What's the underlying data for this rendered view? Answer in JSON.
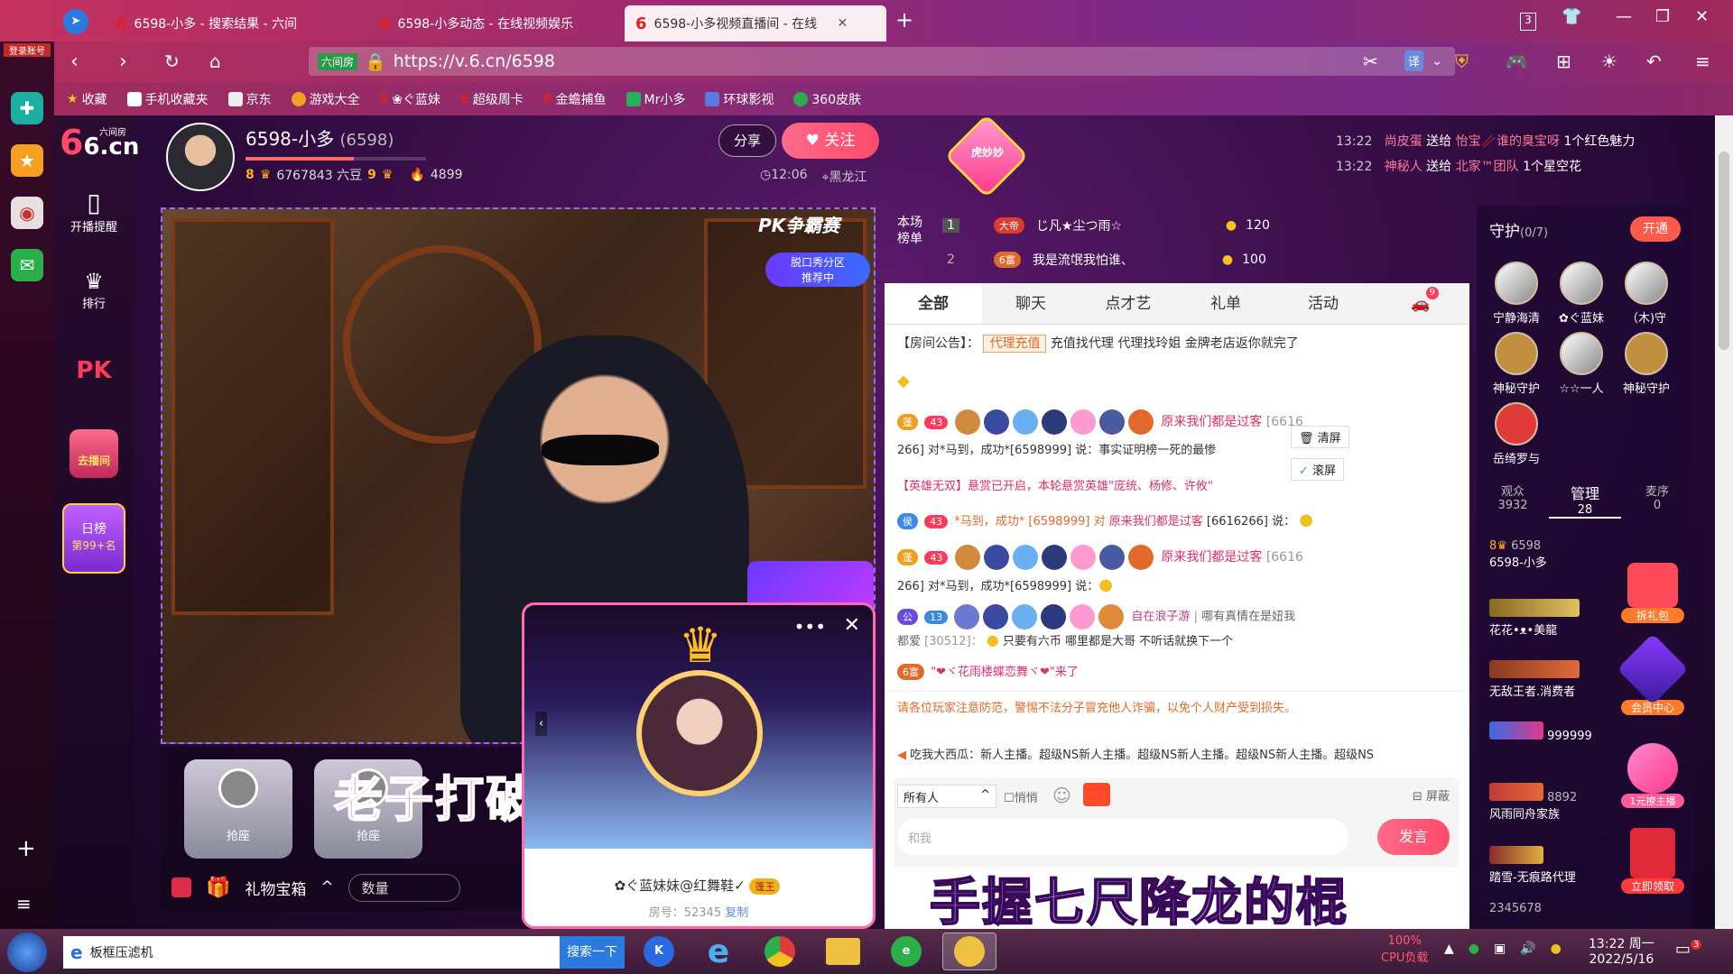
{
  "browser": {
    "tabs": [
      {
        "label": "6598-小多 - 搜索结果 - 六间"
      },
      {
        "label": "6598-小多动态 - 在线视频娱乐"
      },
      {
        "label": "6598-小多视频直播间 - 在线"
      }
    ],
    "tab_count_badge": "3",
    "url": "https://v.6.cn/6598",
    "url_badge": "六间房",
    "translate_label": "译",
    "bookmarks": [
      "收藏",
      "手机收藏夹",
      "京东",
      "游戏大全",
      "❀ぐ蓝妹",
      "超级周卡",
      "金蟾捕鱼",
      "Mr小多",
      "环球影视",
      "360皮肤"
    ]
  },
  "left_sidebar": {
    "login_label": "登录账号"
  },
  "site": {
    "logo_main": "6.cn",
    "logo_sub": "六间房",
    "nav": [
      {
        "label": "开播提醒"
      },
      {
        "label": "排行"
      },
      {
        "label": "PK"
      },
      {
        "label": "去播间"
      },
      {
        "label": "日榜",
        "sub": "第99+名"
      }
    ]
  },
  "streamer": {
    "name": "6598-小多",
    "room_id": "(6598)",
    "level_left": "8",
    "beans": "6767843 六豆",
    "level_right": "9",
    "fans": "4899",
    "time": "12:06",
    "location": "黑龙江",
    "share_label": "分享",
    "follow_label": "关注",
    "hu_label": "虎妙妙"
  },
  "ticker": [
    {
      "time": "13:22",
      "from": "尚皮蛋",
      "verb": "送给",
      "to": "怡宝🥢谁的臭宝呀",
      "gift": "1个红色魅力"
    },
    {
      "time": "13:22",
      "from": "神秘人",
      "verb": "送给",
      "to": "北家™团队",
      "gift": "1个星空花"
    }
  ],
  "video": {
    "pk_label": "PK争霸赛",
    "zone_label": "脱口秀分区",
    "zone_sub": "推荐中"
  },
  "controls": {
    "seats": [
      "抢座",
      "抢座"
    ],
    "gift_box_label": "礼物宝箱",
    "quantity_label": "数量"
  },
  "lyrics": {
    "line1": "老子打破这江湖的阵",
    "line2": "手握七尺降龙的棍"
  },
  "popup": {
    "name": "✿ぐ蓝妹妹@红舞鞋✓",
    "badge": "蓬王",
    "room": "房号：52345",
    "copy": "复制"
  },
  "rank": {
    "title": "本场榜单",
    "rows": [
      {
        "pos": "1",
        "badge": "大帝",
        "name": "じ凡★尘つ雨☆",
        "score": "120"
      },
      {
        "pos": "2",
        "badge": "6富",
        "name": "我是流氓我怕谁、",
        "score": "100"
      }
    ]
  },
  "chat": {
    "tabs": [
      "全部",
      "聊天",
      "点才艺",
      "礼单",
      "活动"
    ],
    "car_badge": "9",
    "announcement_prefix": "【房间公告】：",
    "announcement_tag": "代理充值",
    "announcement_text": "充值找代理 代理找玲姐 金牌老店返你就完了",
    "msg1_user": "原来我们都是过客",
    "msg1_line1_tail": "[6616",
    "msg1_line2": "266] 对*马到，成功*[6598999] 说：事实证明榜一死的最惨",
    "clear_label": "清屏",
    "scroll_label": "滚屏",
    "hero_text": "【英雄无双】悬赏已开启，本轮悬赏英雄\"庞统、杨修、许攸\"",
    "msg2_prefix": "*马到，成功* [6598999] 对",
    "msg2_user": "原来我们都是过客",
    "msg2_tail": "[6616266] 说：",
    "msg3_user": "原来我们都是过客",
    "msg3_line1_tail": "[6616",
    "msg3_line2": "266] 对*马到，成功*[6598999] 说：",
    "msg4_user": "自在浪子游",
    "msg4_mid": "哪有真情在是妞我",
    "msg4_line2_a": "都爱",
    "msg4_line2_b": "[30512]：",
    "msg4_line2_c": "只要有六币 哪里都是大哥 不听话就换下一个",
    "msg5": "\"❤ヾ花雨楼蝶恋舞ヾ❤\"来了",
    "warning": "请各位玩家注意防范，警惕不法分子冒充他人诈骗，以免个人财产受到损失。",
    "marquee": "吃我大西瓜：新人主播。超级NS新人主播。超级NS新人主播。超级NS新人主播。超级NS",
    "target_label": "所有人",
    "whisper_label": "悄悄",
    "block_label": "屏蔽",
    "input_placeholder": "和我",
    "send_label": "发言"
  },
  "right_panel": {
    "guard_title": "守护",
    "guard_count": "(0/7)",
    "open_label": "开通",
    "guards": [
      "宁静海清",
      "✿ぐ蓝妹",
      "（木)守",
      "神秘守护",
      "☆☆一人",
      "神秘守护",
      "岳绮罗与"
    ],
    "stats": [
      {
        "label": "观众",
        "value": "3932"
      },
      {
        "label": "管理",
        "value": "28"
      },
      {
        "label": "麦序",
        "value": "0"
      }
    ],
    "users": [
      "6598-小多",
      "花花•ᴥ•美龍",
      "无敌王者.消费者",
      "999999",
      "风雨同舟家族",
      "踏雪-无痕路代理"
    ],
    "u1_num": "6598",
    "u5_num": "8892",
    "u7_num": "2345678",
    "promos": [
      "拆礼包",
      "会员中心",
      "1元撩主播",
      "立即领取"
    ]
  },
  "taskbar": {
    "start_item": "板框压滤机",
    "search_label": "搜索一下",
    "cpu": "100%",
    "cpu_label": "CPU负载",
    "time": "13:22 周一",
    "date": "2022/5/16",
    "notif": "3"
  }
}
